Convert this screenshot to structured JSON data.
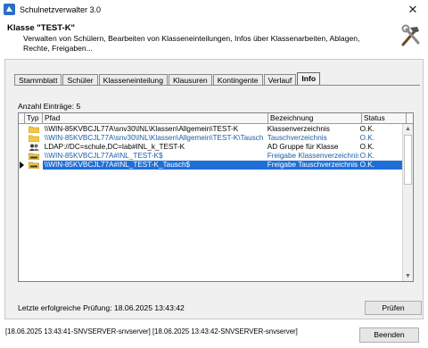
{
  "window": {
    "title": "Schulnetzverwalter 3.0",
    "close_glyph": "✕"
  },
  "header": {
    "title": "Klasse \"TEST-K\"",
    "description": "Verwalten von Schülern, Bearbeiten von Klasseneinteilungen, Infos über Klassenarbeiten, Ablagen, Rechte, Freigaben...",
    "icon": "hammer-wrench-icon"
  },
  "tabs": [
    {
      "label": "Stammblatt",
      "active": false
    },
    {
      "label": "Schüler",
      "active": false
    },
    {
      "label": "Klasseneinteilung",
      "active": false
    },
    {
      "label": "Klausuren",
      "active": false
    },
    {
      "label": "Kontingente",
      "active": false
    },
    {
      "label": "Verlauf",
      "active": false
    },
    {
      "label": "Info",
      "active": true
    }
  ],
  "info": {
    "count_label": "Anzahl Einträge: 5",
    "columns": {
      "typ": "Typ",
      "pfad": "Pfad",
      "bezeichnung": "Bezeichnung",
      "status": "Status"
    },
    "rows": [
      {
        "icon": "folder-icon",
        "pfad": "\\\\WIN-85KVBCJL77A\\snv30\\INL\\Klassen\\Allgemein\\TEST-K",
        "bezeichnung": "Klassenverzeichnis",
        "status": "O.K.",
        "color": "#000000"
      },
      {
        "icon": "folder-icon",
        "pfad": "\\\\WIN-85KVBCJL77A\\snv30\\INL\\Klassen\\Allgemein\\TEST-K\\Tausch",
        "bezeichnung": "Tauschverzeichnis",
        "status": "O.K.",
        "color": "#1a5ea8"
      },
      {
        "icon": "group-icon",
        "pfad": "LDAP://DC=schule,DC=lab#INL_k_TEST-K",
        "bezeichnung": "AD Gruppe für Klasse",
        "status": "O.K.",
        "color": "#000000"
      },
      {
        "icon": "shared-folder-icon",
        "pfad": "\\\\WIN-85KVBCJL77A#INL_TEST-K$",
        "bezeichnung": "Freigabe Klassenverzeichnis",
        "status": "O.K.",
        "color": "#1a5ea8"
      },
      {
        "icon": "shared-folder-icon",
        "pfad": "\\\\WIN-85KVBCJL77A#INL_TEST-K_Tausch$",
        "bezeichnung": "Freigabe Tauschverzeichnis",
        "status": "O.K.",
        "color": "#1a5ea8",
        "selected": true
      }
    ],
    "last_check_label": "Letzte erfolgreiche Prüfung: 18.06.2025 13:43:42",
    "check_button": "Prüfen"
  },
  "status_bar": {
    "text": "[18.06.2025 13:43:41-SNVSERVER-snvserver] [18.06.2025 13:43:42-SNVSERVER-snvserver]"
  },
  "footer": {
    "close_button": "Beenden"
  },
  "colors": {
    "selection": "#1e6fd8",
    "link_blue": "#1a5ea8",
    "folder": "#f2c744"
  }
}
